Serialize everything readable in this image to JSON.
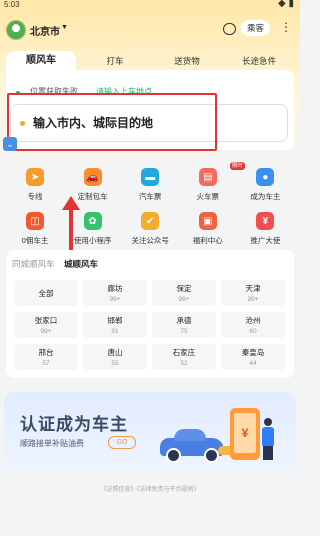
{
  "status": {
    "time": "5:03",
    "icons": "◆ ▮"
  },
  "header": {
    "city": "北京市",
    "identity": "乘客",
    "more": "⋮",
    "caret": "▼"
  },
  "tabs": [
    "顺风车",
    "打车",
    "送货物",
    "长途急件"
  ],
  "location": {
    "status_text": "位置获取失败",
    "relocate_text": "请输入上车地点"
  },
  "destination": {
    "placeholder": "输入市内、城际目的地"
  },
  "mini_button": "⌄",
  "services": [
    {
      "label": "专线",
      "icon": "route-icon",
      "color": "#f39b2b",
      "glyph": "➤"
    },
    {
      "label": "定制包车",
      "icon": "car-icon",
      "color": "#ff8a2a",
      "glyph": "🚗"
    },
    {
      "label": "汽车票",
      "icon": "bus-ticket-icon",
      "color": "#1fa9e0",
      "glyph": "▬"
    },
    {
      "label": "火车票",
      "icon": "train-ticket-icon",
      "color": "#f26b5b",
      "glyph": "▤",
      "badge": "限时"
    },
    {
      "label": "成为车主",
      "icon": "driver-icon",
      "color": "#3a8ff0",
      "glyph": "●"
    },
    {
      "label": "0佣车主",
      "icon": "bag-icon",
      "color": "#ef5a2f",
      "glyph": "◫"
    },
    {
      "label": "使用小程序",
      "icon": "mini-program-icon",
      "color": "#35c36a",
      "glyph": "✿"
    },
    {
      "label": "关注公众号",
      "icon": "follow-icon",
      "color": "#f4ac2c",
      "glyph": "✔"
    },
    {
      "label": "福利中心",
      "icon": "gift-icon",
      "color": "#f0623e",
      "glyph": "▣"
    },
    {
      "label": "推广大使",
      "icon": "ambassador-icon",
      "color": "#ee4f4f",
      "glyph": "¥"
    }
  ],
  "routes": {
    "tab_inactive": "同城顺风车",
    "tab_active": "城顺风车",
    "cells": [
      {
        "name": "全部",
        "count": ""
      },
      {
        "name": "廊坊",
        "count": "99+"
      },
      {
        "name": "保定",
        "count": "99+"
      },
      {
        "name": "天津",
        "count": "99+"
      },
      {
        "name": "张家口",
        "count": "99+"
      },
      {
        "name": "邯郸",
        "count": "91"
      },
      {
        "name": "承德",
        "count": "75"
      },
      {
        "name": "沧州",
        "count": "60"
      },
      {
        "name": "邢台",
        "count": "57"
      },
      {
        "name": "唐山",
        "count": "55"
      },
      {
        "name": "石家庄",
        "count": "52"
      },
      {
        "name": "秦皇岛",
        "count": "44"
      }
    ]
  },
  "banner": {
    "title": "认证成为车主",
    "subtitle": "顺路接单补贴油费",
    "go": "GO",
    "phone_glyph": "¥"
  },
  "footer": {
    "text": "《证照信息》《法律免责与平台规则》"
  }
}
